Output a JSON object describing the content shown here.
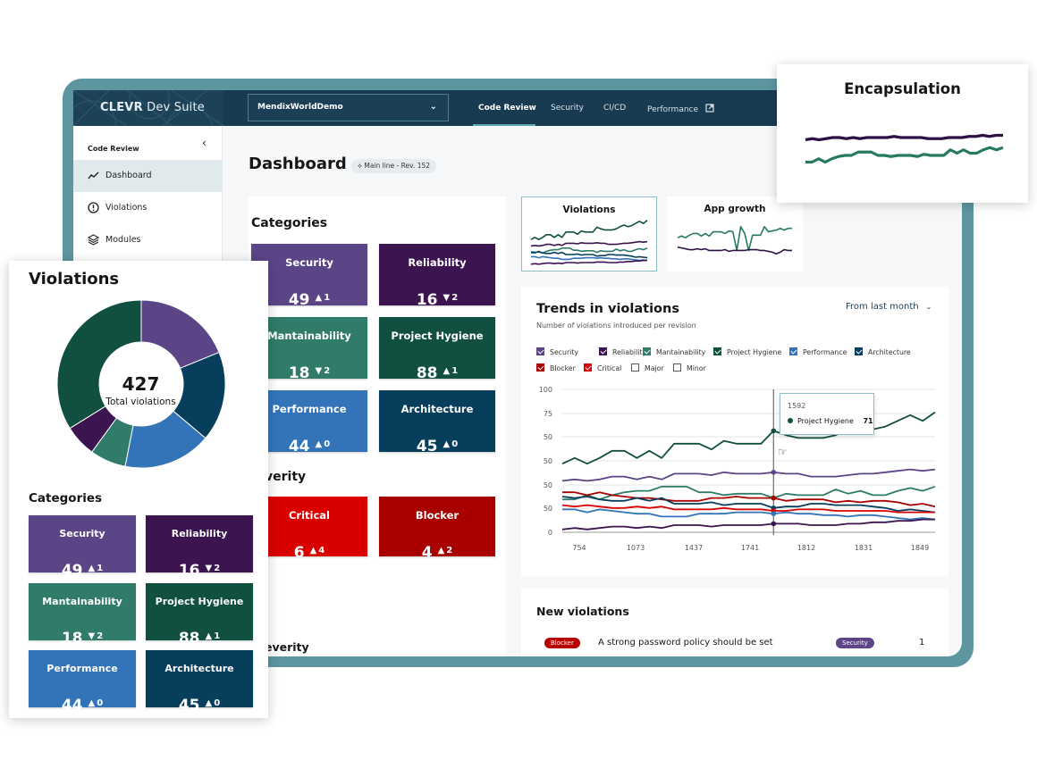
{
  "app": {
    "brand_strong": "CLEVR",
    "brand_rest": " Dev Suite",
    "project_select": "MendixWorldDemo",
    "nav_tabs": [
      {
        "label": "Code Review",
        "active": true
      },
      {
        "label": "Security",
        "active": false
      },
      {
        "label": "CI/CD",
        "active": false
      },
      {
        "label": "Performance",
        "active": false,
        "external": true
      }
    ]
  },
  "sidebar": {
    "heading": "Code Review",
    "items": [
      {
        "label": "Dashboard",
        "icon": "chart-line-icon",
        "active": true
      },
      {
        "label": "Violations",
        "icon": "warning-circle-icon",
        "active": false
      },
      {
        "label": "Modules",
        "icon": "layers-icon",
        "active": false
      }
    ]
  },
  "page": {
    "title": "Dashboard",
    "revision_badge": "Main line - Rev. 152"
  },
  "categories": {
    "title": "Categories",
    "tiles": [
      {
        "name": "Security",
        "value": "49",
        "delta": "1",
        "direction": "up",
        "color": "#5b4587"
      },
      {
        "name": "Reliability",
        "value": "16",
        "delta": "2",
        "direction": "down",
        "color": "#3b1450"
      },
      {
        "name": "Mantainability",
        "value": "18",
        "delta": "2",
        "direction": "down",
        "color": "#307b69"
      },
      {
        "name": "Project Hygiene",
        "value": "88",
        "delta": "1",
        "direction": "up",
        "color": "#114f40"
      },
      {
        "name": "Performance",
        "value": "44",
        "delta": "0",
        "direction": "up",
        "color": "#3374b9"
      },
      {
        "name": "Architecture",
        "value": "45",
        "delta": "0",
        "direction": "up",
        "color": "#073e5c"
      }
    ]
  },
  "severity": {
    "title": "Severity",
    "title_partial_1": "verity",
    "title_partial_2": "everity",
    "tiles": [
      {
        "name": "Critical",
        "value": "6",
        "delta": "4",
        "direction": "up",
        "color": "#da0000"
      },
      {
        "name": "Blocker",
        "value": "4",
        "delta": "2",
        "direction": "up",
        "color": "#a90000"
      }
    ]
  },
  "mini_charts": [
    {
      "title": "Violations",
      "selected": true
    },
    {
      "title": "App growth",
      "selected": false
    }
  ],
  "trends": {
    "title": "Trends in violations",
    "subtitle": "Number of violations introduced per revision",
    "range_select": "From last month",
    "legend": [
      {
        "label": "Security",
        "checked": true,
        "color": "#5b4587"
      },
      {
        "label": "Reliability",
        "checked": true,
        "color": "#3b1450"
      },
      {
        "label": "Mantainability",
        "checked": true,
        "color": "#307b69"
      },
      {
        "label": "Project Hygiene",
        "checked": true,
        "color": "#114f40"
      },
      {
        "label": "Performance",
        "checked": true,
        "color": "#3374b9"
      },
      {
        "label": "Architecture",
        "checked": true,
        "color": "#073e5c"
      },
      {
        "label": "Blocker",
        "checked": true,
        "color": "#a90000"
      },
      {
        "label": "Critical",
        "checked": true,
        "color": "#da0000"
      },
      {
        "label": "Major",
        "checked": false,
        "color": "#ffffff"
      },
      {
        "label": "Minor",
        "checked": false,
        "color": "#ffffff"
      }
    ],
    "tooltip": {
      "revision": "1592",
      "series": "Project Hygiene",
      "value": "71"
    }
  },
  "new_violations": {
    "title": "New violations",
    "rows": [
      {
        "severity": "Blocker",
        "message": "A strong password policy should be set",
        "category": "Security",
        "count": "1"
      }
    ]
  },
  "violations_overlay": {
    "title": "Violations",
    "total": "427",
    "total_label": "Total violations",
    "categories_title": "Categories"
  },
  "encapsulation_overlay": {
    "title": "Encapsulation"
  },
  "chart_data": [
    {
      "type": "line",
      "title": "Trends in violations",
      "xlabel": "",
      "ylabel": "",
      "x_ticks": [
        "754",
        "1073",
        "1437",
        "1741",
        "1812",
        "1831",
        "1849"
      ],
      "y_tick_labels": [
        "0",
        "50",
        "50",
        "50",
        "50",
        "75",
        "100"
      ],
      "ylim": [
        0,
        100
      ],
      "grid": true,
      "n_points": 31,
      "hover_index": 17,
      "series": [
        {
          "name": "Project Hygiene",
          "color": "#114f40",
          "values": [
            48,
            52,
            48,
            52,
            57,
            57,
            52,
            57,
            52,
            62,
            62,
            62,
            58,
            64,
            62,
            62,
            62,
            71,
            68,
            66,
            66,
            66,
            68,
            72,
            75,
            72,
            74,
            78,
            82,
            78,
            84
          ]
        },
        {
          "name": "Security",
          "color": "#5b4587",
          "values": [
            36,
            37,
            36,
            37,
            39,
            39,
            37,
            39,
            37,
            41,
            41,
            41,
            40,
            42,
            41,
            41,
            41,
            42,
            41,
            41,
            39,
            39,
            39,
            40,
            41,
            41,
            42,
            43,
            44,
            43,
            44
          ]
        },
        {
          "name": "Mantainability",
          "color": "#307b69",
          "values": [
            23,
            23,
            26,
            23,
            26,
            28,
            29,
            29,
            32,
            32,
            32,
            28,
            28,
            26,
            27,
            27,
            27,
            24,
            27,
            26,
            26,
            26,
            30,
            27,
            29,
            26,
            26,
            29,
            31,
            29,
            32
          ]
        },
        {
          "name": "Blocker",
          "color": "#a90000",
          "values": [
            28,
            28,
            26,
            28,
            26,
            25,
            24,
            24,
            23,
            22,
            22,
            22,
            24,
            24,
            25,
            24,
            24,
            24,
            22,
            23,
            23,
            23,
            21,
            22,
            21,
            22,
            22,
            21,
            19,
            20,
            18
          ]
        },
        {
          "name": "Architecture",
          "color": "#073e5c",
          "values": [
            25,
            24,
            25,
            23,
            22,
            22,
            24,
            22,
            24,
            20,
            20,
            20,
            21,
            19,
            20,
            20,
            20,
            17,
            18,
            18,
            20,
            20,
            19,
            19,
            19,
            18,
            17,
            15,
            16,
            15,
            14
          ]
        },
        {
          "name": "Critical",
          "color": "#da0000",
          "values": [
            19,
            18,
            19,
            18,
            17,
            17,
            18,
            17,
            18,
            16,
            16,
            16,
            16,
            17,
            16,
            16,
            16,
            15,
            15,
            16,
            16,
            16,
            15,
            15,
            15,
            15,
            15,
            14,
            14,
            14,
            14
          ]
        },
        {
          "name": "Performance",
          "color": "#3374b9",
          "values": [
            16,
            16,
            14,
            16,
            15,
            14,
            13,
            13,
            11,
            11,
            11,
            13,
            13,
            13,
            14,
            14,
            14,
            13,
            14,
            13,
            13,
            12,
            12,
            11,
            12,
            12,
            11,
            10,
            9,
            10,
            9
          ]
        },
        {
          "name": "Reliability",
          "color": "#3b1450",
          "values": [
            2,
            3,
            2,
            3,
            4,
            4,
            3,
            4,
            3,
            5,
            5,
            5,
            4,
            5,
            5,
            5,
            5,
            6,
            6,
            6,
            5,
            5,
            5,
            6,
            6,
            7,
            7,
            8,
            8,
            9,
            9
          ]
        }
      ]
    },
    {
      "type": "pie",
      "title": "Violations",
      "center_label": "427 Total violations",
      "slices": [
        {
          "name": "Security",
          "value": 49,
          "color": "#5b4587"
        },
        {
          "name": "Architecture",
          "value": 45,
          "color": "#073e5c"
        },
        {
          "name": "Performance",
          "value": 44,
          "color": "#3374b9"
        },
        {
          "name": "Mantainability",
          "value": 18,
          "color": "#307b69"
        },
        {
          "name": "Reliability",
          "value": 16,
          "color": "#3b1450"
        },
        {
          "name": "Project Hygiene",
          "value": 88,
          "color": "#114f40"
        }
      ]
    },
    {
      "type": "line",
      "title": "Encapsulation",
      "series": [
        {
          "name": "series-1",
          "color": "#2e1246",
          "values": [
            60,
            61,
            60,
            61,
            62,
            62,
            61,
            62,
            61,
            62,
            62,
            62,
            62,
            63,
            62,
            62,
            62,
            62,
            61,
            61,
            61,
            62,
            62,
            62,
            63,
            63,
            64,
            63,
            64,
            64
          ]
        },
        {
          "name": "series-2",
          "color": "#257a5f",
          "values": [
            40,
            40,
            43,
            40,
            43,
            45,
            46,
            46,
            49,
            49,
            49,
            46,
            46,
            45,
            46,
            46,
            46,
            45,
            47,
            46,
            46,
            46,
            51,
            48,
            51,
            48,
            48,
            51,
            53,
            51,
            53
          ]
        }
      ]
    },
    {
      "type": "line",
      "title": "Violations (mini)",
      "series": [
        {
          "name": "Project Hygiene",
          "color": "#114f40",
          "values": [
            48,
            52,
            48,
            52,
            57,
            57,
            52,
            57,
            52,
            62,
            62,
            62,
            58,
            64,
            62,
            62,
            62,
            71,
            68,
            66,
            66,
            66,
            68,
            72,
            75,
            72,
            74,
            78,
            82,
            78,
            84
          ]
        },
        {
          "name": "Security",
          "color": "#3b1450",
          "values": [
            36,
            37,
            36,
            37,
            39,
            39,
            37,
            39,
            37,
            41,
            41,
            41,
            40,
            42,
            41,
            41,
            41,
            42,
            41,
            41,
            39,
            39,
            39,
            40,
            41,
            41,
            42,
            43,
            44,
            43,
            44
          ]
        },
        {
          "name": "Mantainability",
          "color": "#307b69",
          "values": [
            23,
            23,
            26,
            23,
            26,
            28,
            29,
            29,
            32,
            32,
            32,
            28,
            28,
            26,
            27,
            27,
            27,
            24,
            27,
            26,
            26,
            26,
            30,
            27,
            29,
            26,
            26,
            29,
            31,
            29,
            32
          ]
        },
        {
          "name": "Architecture",
          "color": "#073e5c",
          "values": [
            25,
            24,
            25,
            23,
            22,
            22,
            24,
            22,
            24,
            20,
            20,
            20,
            21,
            19,
            20,
            20,
            20,
            17,
            18,
            18,
            20,
            20,
            19,
            19,
            19,
            18,
            17,
            15,
            16,
            15,
            14
          ]
        },
        {
          "name": "Performance",
          "color": "#3374b9",
          "values": [
            16,
            16,
            14,
            16,
            15,
            14,
            13,
            13,
            11,
            11,
            11,
            13,
            13,
            13,
            14,
            14,
            14,
            13,
            14,
            13,
            13,
            12,
            12,
            11,
            12,
            12,
            11,
            10,
            9,
            10,
            9
          ]
        },
        {
          "name": "Reliability",
          "color": "#3b1450",
          "values": [
            2,
            3,
            2,
            3,
            4,
            4,
            3,
            4,
            3,
            5,
            5,
            5,
            4,
            5,
            5,
            5,
            5,
            6,
            6,
            6,
            5,
            5,
            5,
            6,
            6,
            7,
            7,
            8,
            8,
            9,
            9
          ]
        }
      ]
    },
    {
      "type": "line",
      "title": "App growth",
      "series": [
        {
          "name": "series-1",
          "color": "#257a5f",
          "values": [
            55,
            57,
            55,
            58,
            60,
            60,
            57,
            60,
            57,
            62,
            62,
            62,
            60,
            63,
            62,
            40,
            68,
            60,
            40,
            58,
            58,
            58,
            68,
            62,
            63,
            64,
            66,
            64,
            66,
            66
          ]
        },
        {
          "name": "series-2",
          "color": "#2e1246",
          "values": [
            44,
            43,
            42,
            41,
            41,
            42,
            41,
            42,
            40,
            40,
            40,
            40,
            41,
            39,
            40,
            40,
            40,
            40,
            41,
            41,
            41,
            40,
            40,
            39,
            38,
            36,
            38,
            41,
            40,
            40
          ]
        }
      ]
    }
  ]
}
